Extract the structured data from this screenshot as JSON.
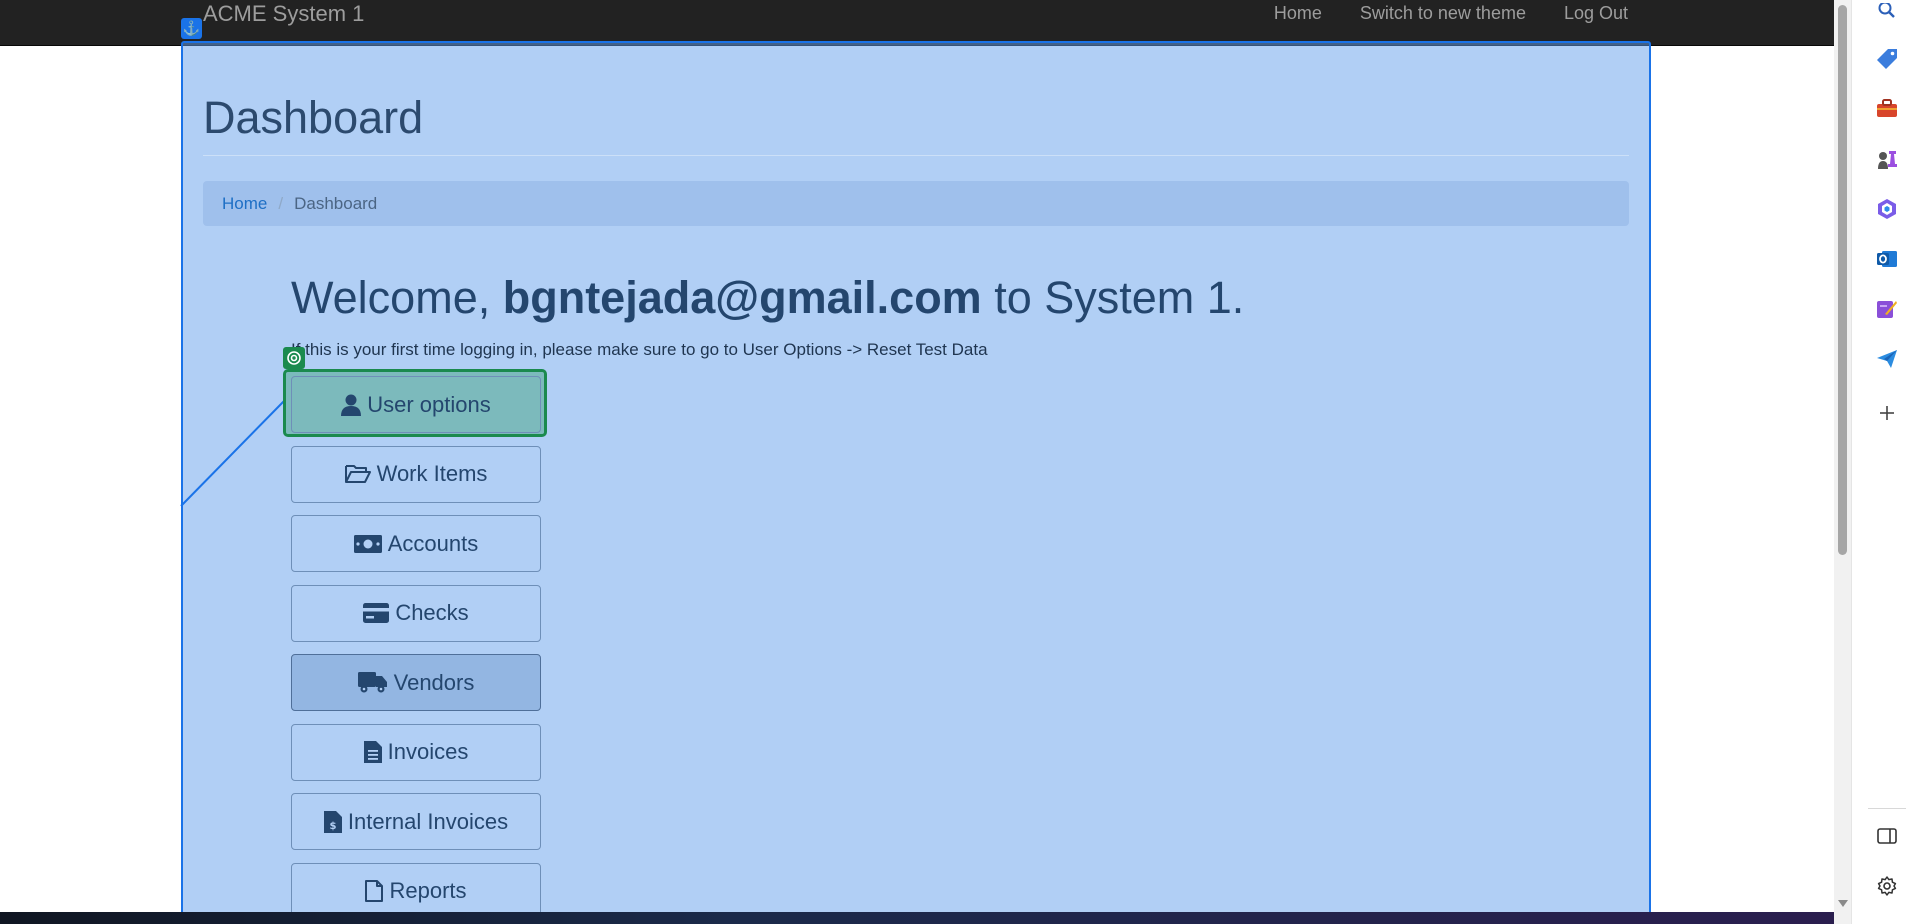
{
  "navbar": {
    "brand": "ACME System 1",
    "links": [
      "Home",
      "Switch to new theme",
      "Log Out"
    ]
  },
  "page": {
    "title": "Dashboard",
    "breadcrumb": {
      "home": "Home",
      "separator": "/",
      "current": "Dashboard"
    },
    "welcome": {
      "prefix": "Welcome, ",
      "user": "bgntejada@gmail.com",
      "suffix": " to System 1."
    },
    "notice": "If this is your first time logging in, please make sure to go to User Options -> Reset Test Data"
  },
  "buttons": [
    {
      "label": "User options",
      "icon": "user-icon"
    },
    {
      "label": "Work Items",
      "icon": "folder-open-icon"
    },
    {
      "label": "Accounts",
      "icon": "money-bill-icon"
    },
    {
      "label": "Checks",
      "icon": "credit-card-icon"
    },
    {
      "label": "Vendors",
      "icon": "truck-icon",
      "active": true
    },
    {
      "label": "Invoices",
      "icon": "file-text-icon"
    },
    {
      "label": "Internal Invoices",
      "icon": "file-invoice-dollar-icon"
    },
    {
      "label": "Reports",
      "icon": "file-icon"
    }
  ],
  "overlay": {
    "anchor_icon": "⚓",
    "highlight_color": "#1a73e8",
    "focus_color": "#1a8a4e"
  },
  "sidebar_icons": [
    "search-icon",
    "tag-icon",
    "toolbox-icon",
    "chess-icon",
    "copilot-icon",
    "outlook-icon",
    "designer-icon",
    "send-icon",
    "plus-icon",
    "split-screen-icon",
    "settings-icon"
  ]
}
